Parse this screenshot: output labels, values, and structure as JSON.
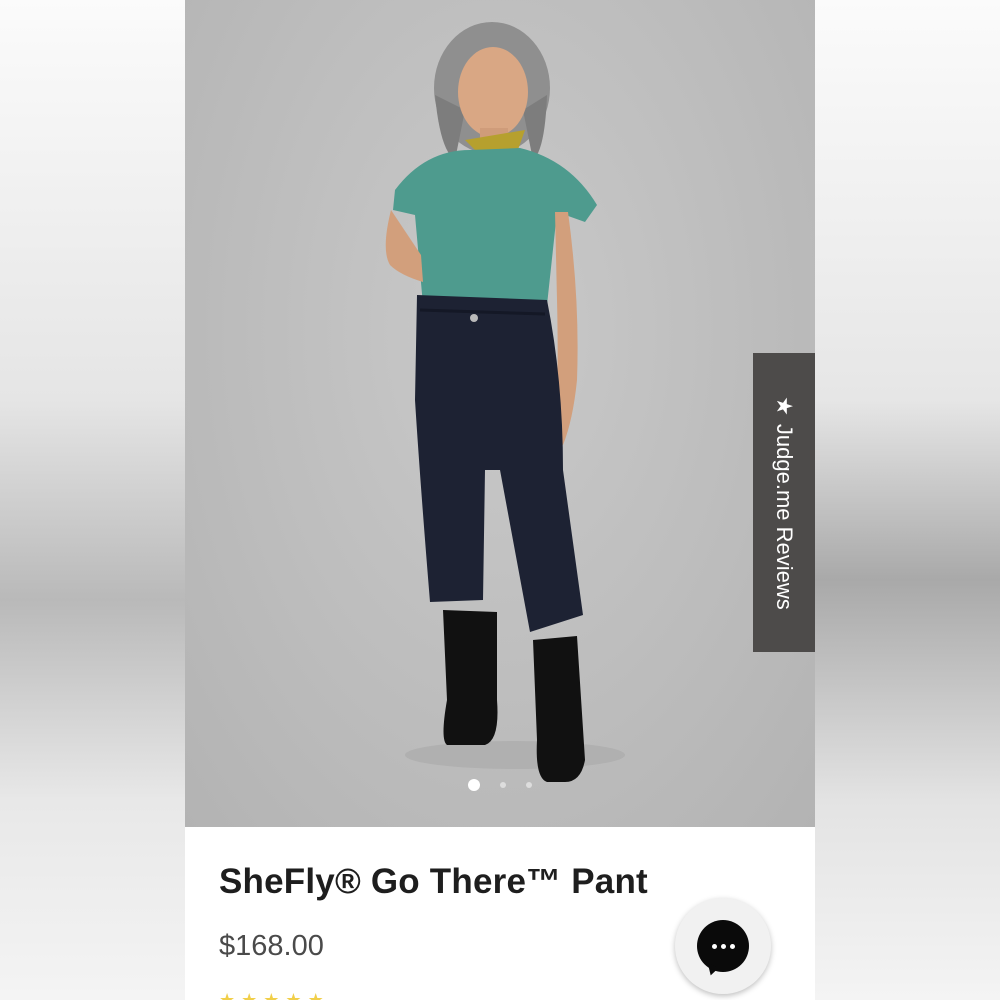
{
  "product": {
    "title": "SheFly® Go There™ Pant",
    "price": "$168.00"
  },
  "reviews_tab": {
    "label": "Judge.me Reviews",
    "icon": "star-icon"
  },
  "carousel": {
    "total_dots": 3,
    "active_index": 0
  },
  "chat": {
    "icon": "chat-bubble-icon"
  },
  "colors": {
    "accent_star": "#f1cf4a",
    "reviews_tab_bg": "#4d4b4a",
    "title_text": "#1e1e1e"
  }
}
